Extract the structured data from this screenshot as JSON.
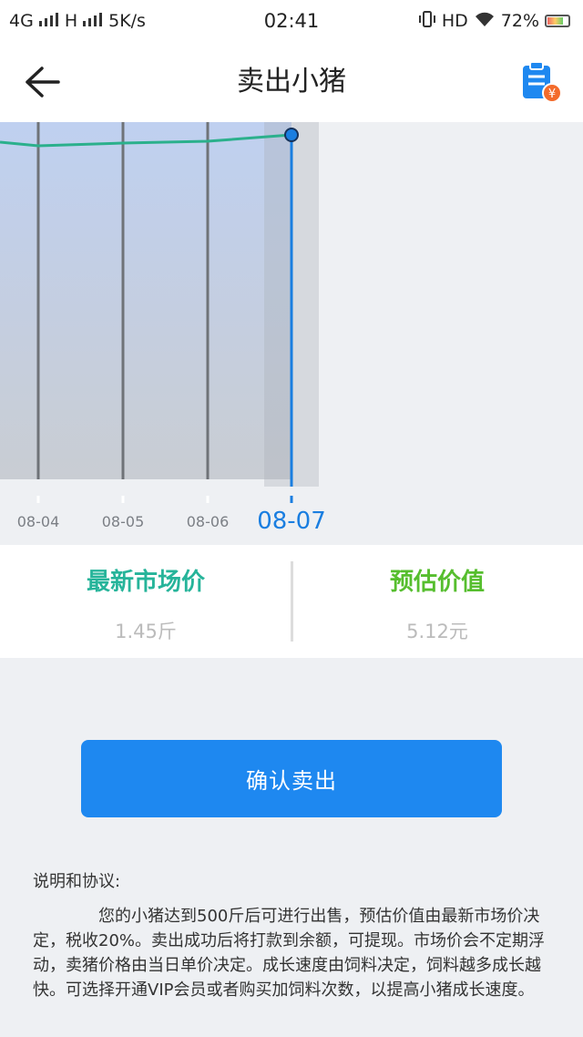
{
  "status_bar": {
    "network": "4G",
    "network2": "H",
    "speed": "5K/s",
    "time": "02:41",
    "hd": "HD",
    "battery": "72%"
  },
  "header": {
    "title": "卖出小猪",
    "back_icon": "arrow-left-icon",
    "right_icon": "order-list-icon"
  },
  "chart_data": {
    "type": "area",
    "categories": [
      "08-04",
      "08-05",
      "08-06",
      "08-07"
    ],
    "selected": "08-07",
    "colors": {
      "line": "#2bb08c",
      "fill_top": "#bfd0f0",
      "cursor": "#1a7ee0"
    }
  },
  "price_panel": {
    "market_price_label": "最新市场价",
    "market_price_value": "1.45斤",
    "estimated_value_label": "预估价值",
    "estimated_value_value": "5.12元"
  },
  "actions": {
    "confirm_label": "确认卖出"
  },
  "notes": {
    "title": "说明和协议:",
    "body": "您的小猪达到500斤后可进行出售，预估价值由最新市场价决定，税收20%。卖出成功后将打款到余额，可提现。市场价会不定期浮动，卖猪价格由当日单价决定。成长速度由饲料决定，饲料越多成长越快。可选择开通VIP会员或者购买加饲料次数，以提高小猪成长速度。"
  }
}
